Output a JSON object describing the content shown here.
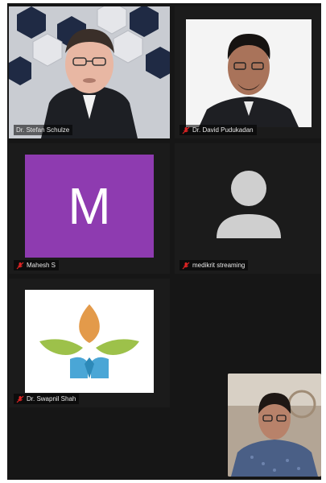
{
  "participants": [
    {
      "name": "Dr. Stefan Schulze",
      "muted": false,
      "active_speaker": true
    },
    {
      "name": "Dr. David Pudukadan",
      "muted": true
    },
    {
      "name": "Mahesh S",
      "muted": true,
      "avatar_letter": "M",
      "avatar_color": "#8e3bb0"
    },
    {
      "name": "medikrit streaming",
      "muted": true
    },
    {
      "name": "Dr. Swapnil Shah",
      "muted": true
    }
  ],
  "colors": {
    "active_border": "#22c55e",
    "muted_icon": "#e02424",
    "stage_bg": "#161616"
  }
}
